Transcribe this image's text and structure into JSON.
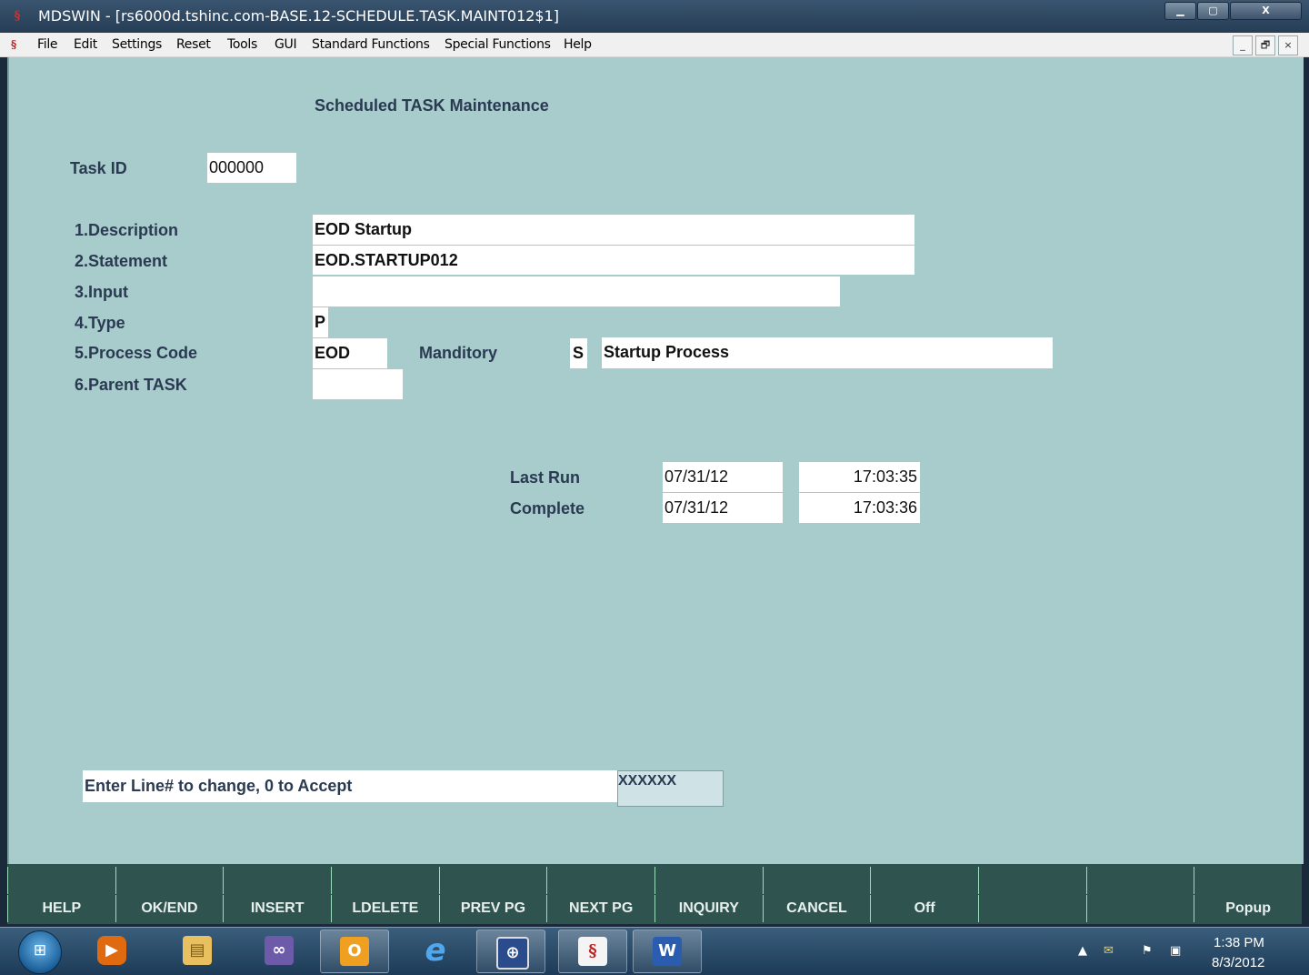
{
  "window": {
    "title": "MDSWIN - [rs6000d.tshinc.com-BASE.12-SCHEDULE.TASK.MAINT012$1]",
    "min_icon": "minimize-icon",
    "max_icon": "maximize-icon",
    "close_label": "X"
  },
  "menu": {
    "items": [
      "File",
      "Edit",
      "Settings",
      "Reset",
      "Tools",
      "GUI",
      "Standard Functions",
      "Special Functions",
      "Help"
    ],
    "mdi_min": "_",
    "mdi_restore": "🗗",
    "mdi_close": "×"
  },
  "form": {
    "heading": "Scheduled TASK Maintenance",
    "task_id": {
      "label": "Task ID",
      "value": "000000"
    },
    "fields": [
      {
        "label": "1.Description",
        "value": "EOD Startup"
      },
      {
        "label": "2.Statement",
        "value": "EOD.STARTUP012"
      },
      {
        "label": "3.Input",
        "value": ""
      },
      {
        "label": "4.Type",
        "value": "P"
      },
      {
        "label": "5.Process Code",
        "value": "EOD"
      },
      {
        "label": "6.Parent TASK",
        "value": ""
      }
    ],
    "manditory": {
      "label": "Manditory",
      "value": "S",
      "description": "Startup Process"
    },
    "last_run": {
      "label": "Last Run",
      "date": "07/31/12",
      "time": "17:03:35"
    },
    "complete": {
      "label": "Complete",
      "date": "07/31/12",
      "time": "17:03:36"
    },
    "prompt": "Enter Line# to change, 0 to Accept",
    "prompt_input": "XXXXXX"
  },
  "fkeys": [
    "HELP",
    "OK/END",
    "INSERT",
    "LDELETE",
    "PREV PG",
    "NEXT PG",
    "INQUIRY",
    "CANCEL",
    "Off",
    "",
    "",
    "Popup"
  ],
  "taskbar": {
    "apps": [
      "media-player-icon",
      "file-explorer-icon",
      "visual-studio-icon",
      "outlook-icon",
      "internet-explorer-icon",
      "remote-desktop-icon",
      "mdswin-icon",
      "word-icon"
    ],
    "time": "1:38 PM",
    "date": "8/3/2012"
  },
  "colors": {
    "form_bg": "#a8cbcb",
    "fkey_bar": "#2f5450",
    "label_text": "#2a3a52",
    "prompt_input_bg": "#cfe3e6"
  }
}
